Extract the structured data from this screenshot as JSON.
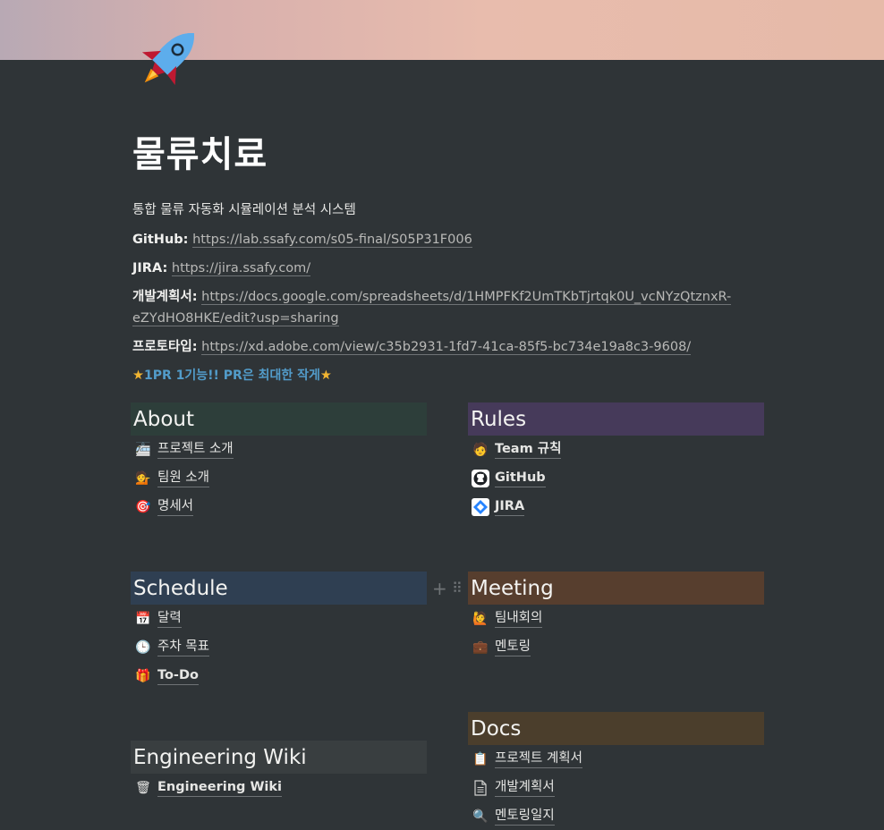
{
  "page": {
    "title": "물류치료",
    "subtitle": "통합 물류 자동화 시뮬레이션 분석 시스템",
    "icon": "rocket-icon"
  },
  "links": {
    "github_label": "GitHub",
    "github_url": "https://lab.ssafy.com/s05-final/S05P31F006",
    "jira_label": "JIRA",
    "jira_url": "https://jira.ssafy.com/",
    "plan_label": "개발계획서",
    "plan_url_1": "https://docs.google.com/spreadsheets/d/1HMPFKf2UmTKbTjrtqk0U_vcNYzQtznxR-",
    "plan_url_2": "eZYdHO8HKE/edit?usp=sharing",
    "proto_label": "프로토타입",
    "proto_url": "https://xd.adobe.com/view/c35b2931-1fd7-41ca-85f5-bc734e19a8c3-9608/"
  },
  "tagline": "1PR 1기능!! PR은 최대한 작게",
  "sections": {
    "about": {
      "title": "About",
      "items": [
        {
          "label": "프로젝트 소개",
          "icon": "train-icon"
        },
        {
          "label": "팀원 소개",
          "icon": "person-tipping-hand-icon"
        },
        {
          "label": "명세서",
          "icon": "target-icon"
        }
      ]
    },
    "rules": {
      "title": "Rules",
      "items": [
        {
          "label": "Team 규칙",
          "icon": "technologist-icon"
        },
        {
          "label": "GitHub",
          "icon": "github-icon"
        },
        {
          "label": "JIRA",
          "icon": "jira-icon"
        }
      ]
    },
    "schedule": {
      "title": "Schedule",
      "items": [
        {
          "label": "달력",
          "icon": "calendar-icon"
        },
        {
          "label": "주차 목표",
          "icon": "clock-icon"
        },
        {
          "label": "To-Do",
          "icon": "gift-icon"
        }
      ]
    },
    "meeting": {
      "title": "Meeting",
      "items": [
        {
          "label": "팀내회의",
          "icon": "raising-hand-icon"
        },
        {
          "label": "멘토링",
          "icon": "briefcase-icon"
        }
      ]
    },
    "docs": {
      "title": "Docs",
      "items": [
        {
          "label": "프로젝트 계획서",
          "icon": "clipboard-icon"
        },
        {
          "label": "개발계획서",
          "icon": "page-icon"
        },
        {
          "label": "멘토링일지",
          "icon": "magnifier-icon"
        }
      ]
    },
    "wiki": {
      "title": "Engineering Wiki",
      "items": [
        {
          "label": "Engineering Wiki",
          "icon": "trash-can-icon"
        }
      ]
    }
  },
  "colors": {
    "background": "#2f3437",
    "about": "#2d3e3a",
    "rules": "#463a5a",
    "schedule": "#2f3f52",
    "meeting": "#573e2e",
    "docs": "#4b3e2c",
    "wiki": "#393e40",
    "tagline": "#529cca"
  }
}
